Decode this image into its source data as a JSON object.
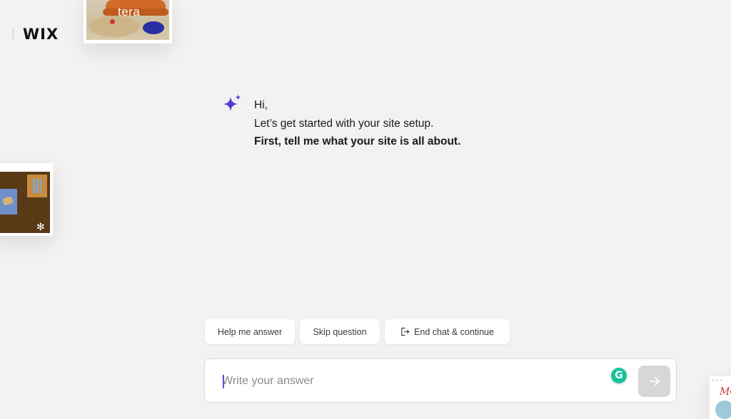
{
  "header": {
    "back_icon": "back-arrow-icon",
    "back_glyph": "‹",
    "logo": "WIX"
  },
  "decor": {
    "card_tera_text": "tera",
    "corner_card_text": "MC"
  },
  "assistant": {
    "icon": "sparkle-icon",
    "line1": "Hi,",
    "line2": "Let’s get started with your site setup.",
    "line3": "First, tell me what your site is all about."
  },
  "chips": {
    "help": "Help me answer",
    "skip": "Skip question",
    "end": "End chat & continue",
    "end_icon": "exit-icon"
  },
  "input": {
    "placeholder": "Write your answer",
    "value": "",
    "grammarly_icon": "grammarly-icon",
    "grammarly_glyph": "G",
    "send_icon": "arrow-right-icon"
  },
  "colors": {
    "background": "#f4f2f0",
    "accent": "#5b4cf0",
    "grammarly": "#15c39a",
    "send_button": "#d8d7d5"
  }
}
